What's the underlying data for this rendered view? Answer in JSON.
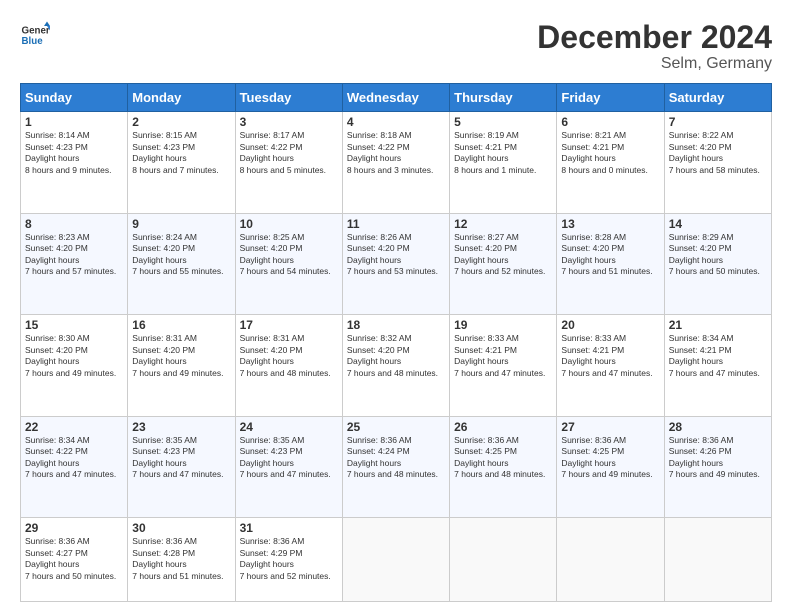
{
  "logo": {
    "line1": "General",
    "line2": "Blue"
  },
  "title": "December 2024",
  "location": "Selm, Germany",
  "days_of_week": [
    "Sunday",
    "Monday",
    "Tuesday",
    "Wednesday",
    "Thursday",
    "Friday",
    "Saturday"
  ],
  "weeks": [
    [
      {
        "day": "1",
        "sunrise": "8:14 AM",
        "sunset": "4:23 PM",
        "daylight": "8 hours and 9 minutes."
      },
      {
        "day": "2",
        "sunrise": "8:15 AM",
        "sunset": "4:23 PM",
        "daylight": "8 hours and 7 minutes."
      },
      {
        "day": "3",
        "sunrise": "8:17 AM",
        "sunset": "4:22 PM",
        "daylight": "8 hours and 5 minutes."
      },
      {
        "day": "4",
        "sunrise": "8:18 AM",
        "sunset": "4:22 PM",
        "daylight": "8 hours and 3 minutes."
      },
      {
        "day": "5",
        "sunrise": "8:19 AM",
        "sunset": "4:21 PM",
        "daylight": "8 hours and 1 minute."
      },
      {
        "day": "6",
        "sunrise": "8:21 AM",
        "sunset": "4:21 PM",
        "daylight": "8 hours and 0 minutes."
      },
      {
        "day": "7",
        "sunrise": "8:22 AM",
        "sunset": "4:20 PM",
        "daylight": "7 hours and 58 minutes."
      }
    ],
    [
      {
        "day": "8",
        "sunrise": "8:23 AM",
        "sunset": "4:20 PM",
        "daylight": "7 hours and 57 minutes."
      },
      {
        "day": "9",
        "sunrise": "8:24 AM",
        "sunset": "4:20 PM",
        "daylight": "7 hours and 55 minutes."
      },
      {
        "day": "10",
        "sunrise": "8:25 AM",
        "sunset": "4:20 PM",
        "daylight": "7 hours and 54 minutes."
      },
      {
        "day": "11",
        "sunrise": "8:26 AM",
        "sunset": "4:20 PM",
        "daylight": "7 hours and 53 minutes."
      },
      {
        "day": "12",
        "sunrise": "8:27 AM",
        "sunset": "4:20 PM",
        "daylight": "7 hours and 52 minutes."
      },
      {
        "day": "13",
        "sunrise": "8:28 AM",
        "sunset": "4:20 PM",
        "daylight": "7 hours and 51 minutes."
      },
      {
        "day": "14",
        "sunrise": "8:29 AM",
        "sunset": "4:20 PM",
        "daylight": "7 hours and 50 minutes."
      }
    ],
    [
      {
        "day": "15",
        "sunrise": "8:30 AM",
        "sunset": "4:20 PM",
        "daylight": "7 hours and 49 minutes."
      },
      {
        "day": "16",
        "sunrise": "8:31 AM",
        "sunset": "4:20 PM",
        "daylight": "7 hours and 49 minutes."
      },
      {
        "day": "17",
        "sunrise": "8:31 AM",
        "sunset": "4:20 PM",
        "daylight": "7 hours and 48 minutes."
      },
      {
        "day": "18",
        "sunrise": "8:32 AM",
        "sunset": "4:20 PM",
        "daylight": "7 hours and 48 minutes."
      },
      {
        "day": "19",
        "sunrise": "8:33 AM",
        "sunset": "4:21 PM",
        "daylight": "7 hours and 47 minutes."
      },
      {
        "day": "20",
        "sunrise": "8:33 AM",
        "sunset": "4:21 PM",
        "daylight": "7 hours and 47 minutes."
      },
      {
        "day": "21",
        "sunrise": "8:34 AM",
        "sunset": "4:21 PM",
        "daylight": "7 hours and 47 minutes."
      }
    ],
    [
      {
        "day": "22",
        "sunrise": "8:34 AM",
        "sunset": "4:22 PM",
        "daylight": "7 hours and 47 minutes."
      },
      {
        "day": "23",
        "sunrise": "8:35 AM",
        "sunset": "4:23 PM",
        "daylight": "7 hours and 47 minutes."
      },
      {
        "day": "24",
        "sunrise": "8:35 AM",
        "sunset": "4:23 PM",
        "daylight": "7 hours and 47 minutes."
      },
      {
        "day": "25",
        "sunrise": "8:36 AM",
        "sunset": "4:24 PM",
        "daylight": "7 hours and 48 minutes."
      },
      {
        "day": "26",
        "sunrise": "8:36 AM",
        "sunset": "4:25 PM",
        "daylight": "7 hours and 48 minutes."
      },
      {
        "day": "27",
        "sunrise": "8:36 AM",
        "sunset": "4:25 PM",
        "daylight": "7 hours and 49 minutes."
      },
      {
        "day": "28",
        "sunrise": "8:36 AM",
        "sunset": "4:26 PM",
        "daylight": "7 hours and 49 minutes."
      }
    ],
    [
      {
        "day": "29",
        "sunrise": "8:36 AM",
        "sunset": "4:27 PM",
        "daylight": "7 hours and 50 minutes."
      },
      {
        "day": "30",
        "sunrise": "8:36 AM",
        "sunset": "4:28 PM",
        "daylight": "7 hours and 51 minutes."
      },
      {
        "day": "31",
        "sunrise": "8:36 AM",
        "sunset": "4:29 PM",
        "daylight": "7 hours and 52 minutes."
      },
      null,
      null,
      null,
      null
    ]
  ]
}
